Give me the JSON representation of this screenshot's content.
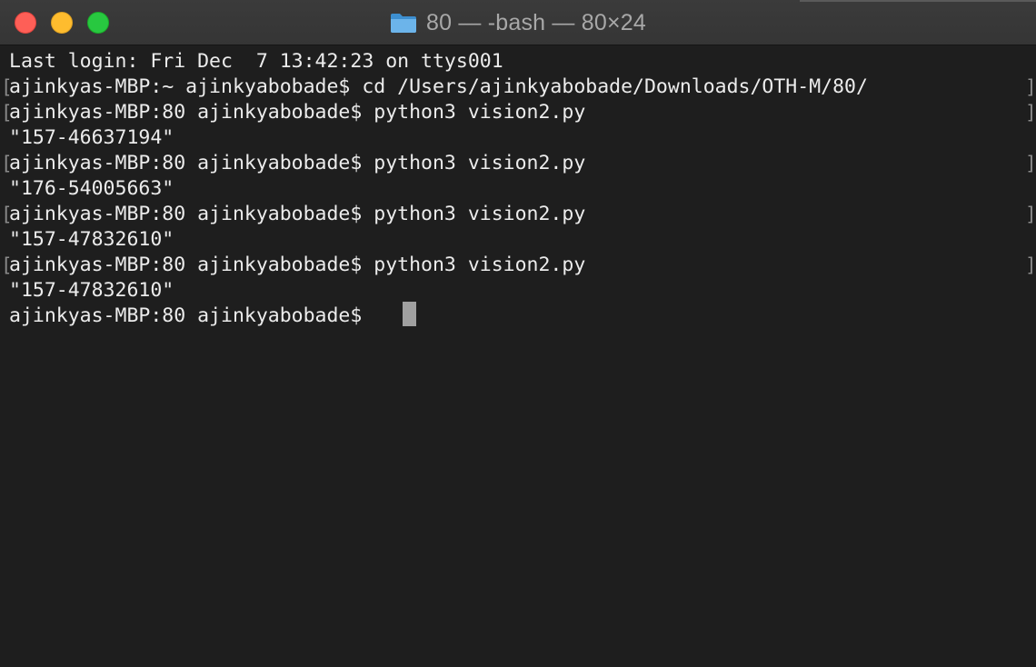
{
  "window": {
    "title": "80 — -bash — 80×24",
    "title_icon": "folder-icon",
    "traffic_lights": {
      "close_color": "#fe5f57",
      "minimize_color": "#febc2e",
      "zoom_color": "#28c840"
    }
  },
  "terminal": {
    "background": "#1e1e1e",
    "foreground": "#ececec",
    "lines": [
      "Last login: Fri Dec  7 13:42:23 on ttys001",
      "ajinkyas-MBP:~ ajinkyabobade$ cd /Users/ajinkyabobade/Downloads/OTH-M/80/",
      "ajinkyas-MBP:80 ajinkyabobade$ python3 vision2.py",
      "\"157-46637194\"",
      "ajinkyas-MBP:80 ajinkyabobade$ python3 vision2.py",
      "\"176-54005663\"",
      "ajinkyas-MBP:80 ajinkyabobade$ python3 vision2.py",
      "\"157-47832610\"",
      "ajinkyas-MBP:80 ajinkyabobade$ python3 vision2.py",
      "\"157-47832610\"",
      "ajinkyas-MBP:80 ajinkyabobade$ "
    ],
    "bracket_open": "[",
    "bracket_close": "]"
  }
}
